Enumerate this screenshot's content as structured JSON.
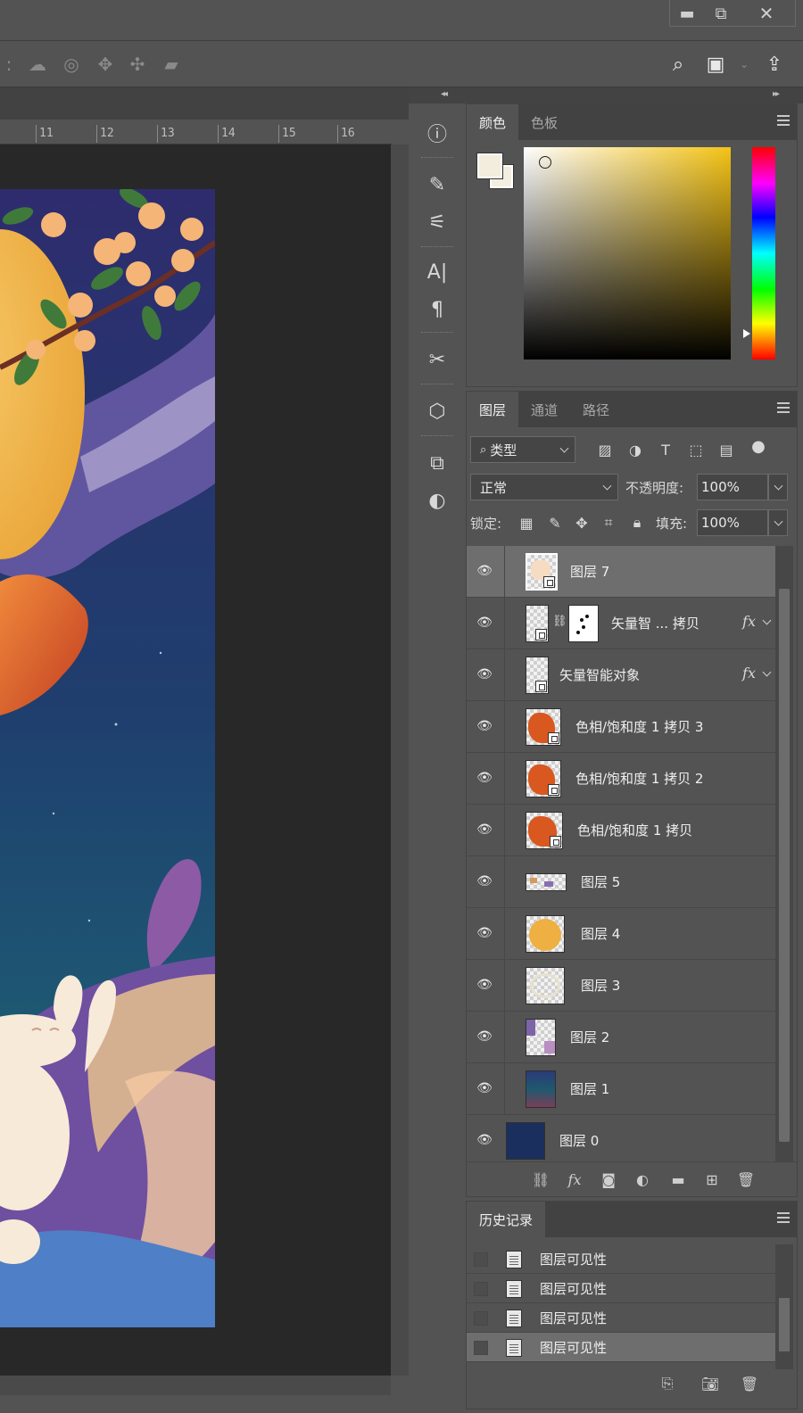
{
  "window": {
    "minimize_glyph": "▬",
    "restore_glyph": "⧉",
    "close_glyph": "✕"
  },
  "options_bar": {
    "icons": [
      "3d-orbit-icon",
      "3d-roll-icon",
      "3d-pan-icon",
      "3d-slide-icon",
      "3d-camera-icon"
    ],
    "right_icons": [
      "search-icon",
      "workspace-icon",
      "share-icon"
    ]
  },
  "ruler": {
    "ticks": [
      "11",
      "12",
      "13",
      "14",
      "15",
      "16"
    ]
  },
  "color_panel": {
    "tabs": [
      "颜色",
      "色板"
    ],
    "active_tab": "颜色",
    "foreground": "#f2eddc",
    "background": "#f3eedf",
    "hue_color": "#f4c316"
  },
  "layers_panel": {
    "tabs": [
      "图层",
      "通道",
      "路径"
    ],
    "active_tab": "图层",
    "filter_label": "类型",
    "blend_mode": "正常",
    "opacity_label": "不透明度:",
    "opacity_value": "100%",
    "lock_label": "锁定:",
    "fill_label": "填充:",
    "fill_value": "100%",
    "layers": [
      {
        "name": "图层 7",
        "selected": true,
        "fx": false
      },
      {
        "name": "矢量智 ... 拷贝",
        "selected": false,
        "fx": true,
        "fx_label": "fx"
      },
      {
        "name": "矢量智能对象",
        "selected": false,
        "fx": true,
        "fx_label": "fx"
      },
      {
        "name": "色相/饱和度 1 拷贝 3",
        "selected": false,
        "fx": false
      },
      {
        "name": "色相/饱和度 1 拷贝 2",
        "selected": false,
        "fx": false
      },
      {
        "name": "色相/饱和度 1 拷贝",
        "selected": false,
        "fx": false
      },
      {
        "name": "图层 5",
        "selected": false,
        "fx": false
      },
      {
        "name": "图层 4",
        "selected": false,
        "fx": false
      },
      {
        "name": "图层 3",
        "selected": false,
        "fx": false
      },
      {
        "name": "图层 2",
        "selected": false,
        "fx": false
      },
      {
        "name": "图层 1",
        "selected": false,
        "fx": false
      },
      {
        "name": "图层 0",
        "selected": false,
        "fx": false
      }
    ],
    "footer_fx": "fx"
  },
  "history_panel": {
    "tab": "历史记录",
    "items": [
      "图层可见性",
      "图层可见性",
      "图层可见性",
      "图层可见性"
    ]
  }
}
